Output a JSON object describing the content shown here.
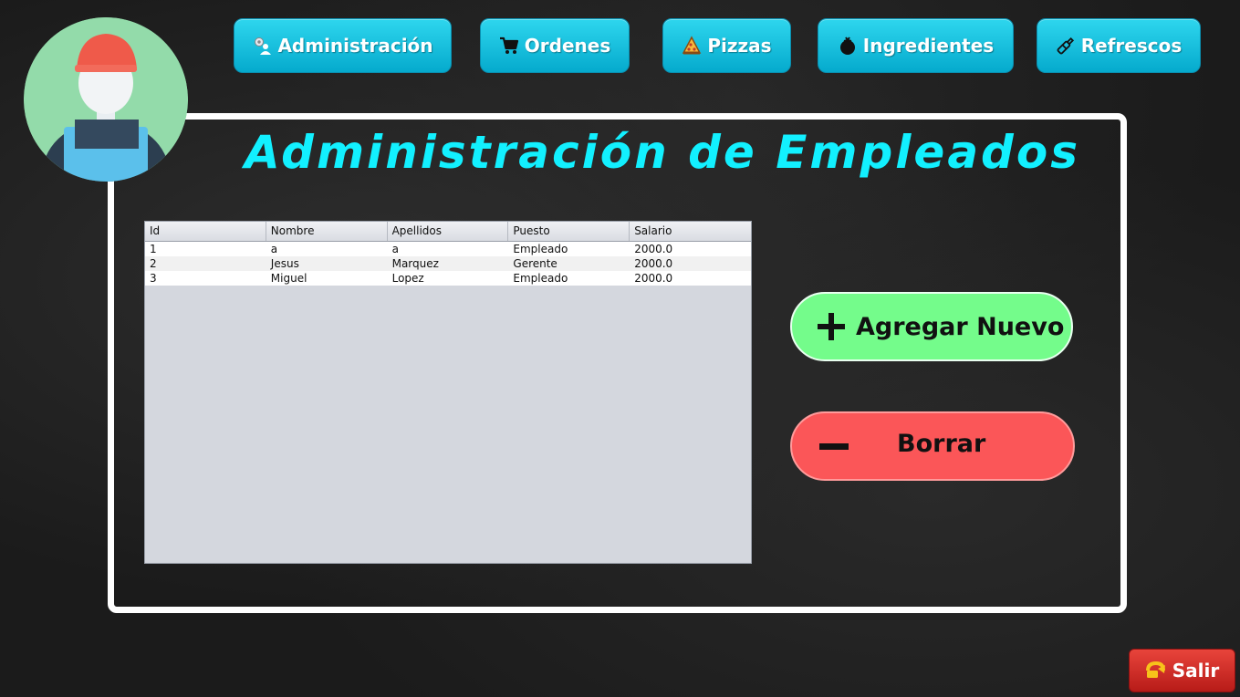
{
  "nav": {
    "items": [
      {
        "label": "Administración",
        "icon": "admin-gear-user-icon"
      },
      {
        "label": "Ordenes",
        "icon": "cart-icon"
      },
      {
        "label": "Pizzas",
        "icon": "pizza-icon"
      },
      {
        "label": "Ingredientes",
        "icon": "tomato-icon"
      },
      {
        "label": "Refrescos",
        "icon": "bottle-icon"
      }
    ]
  },
  "avatar": {
    "icon": "worker-avatar-icon"
  },
  "page": {
    "title": "Administración de Empleados"
  },
  "table": {
    "columns": [
      "Id",
      "Nombre",
      "Apellidos",
      "Puesto",
      "Salario"
    ],
    "rows": [
      [
        "1",
        "a",
        "a",
        "Empleado",
        "2000.0"
      ],
      [
        "2",
        "Jesus",
        "Marquez",
        "Gerente",
        "2000.0"
      ],
      [
        "3",
        "Miguel",
        "Lopez",
        "Empleado",
        "2000.0"
      ]
    ]
  },
  "actions": {
    "add_label": "Agregar Nuevo",
    "delete_label": "Borrar",
    "add_icon": "plus-icon",
    "delete_icon": "minus-icon"
  },
  "exit": {
    "label": "Salir",
    "icon": "exit-arrow-icon"
  },
  "colors": {
    "nav_button": "#0dbfe0",
    "title": "#12f0ff",
    "add_button": "#74fc8b",
    "delete_button": "#fb5658",
    "exit_button": "#d32f2f",
    "panel_border": "#ffffff"
  }
}
